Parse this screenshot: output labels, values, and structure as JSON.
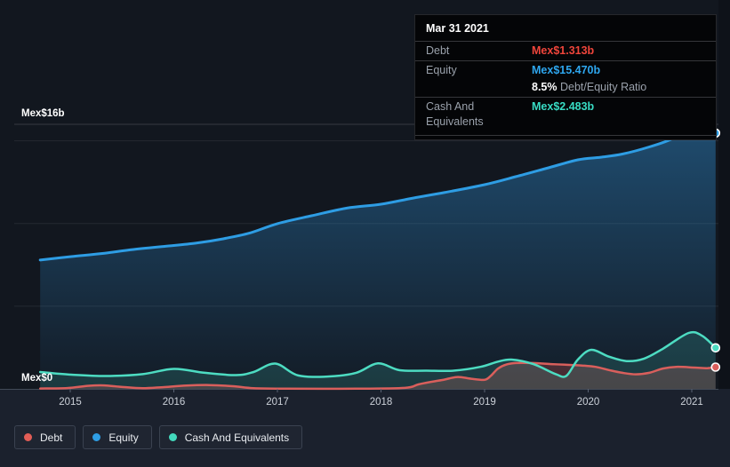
{
  "tooltip": {
    "date": "Mar 31 2021",
    "debt_label": "Debt",
    "debt_value": "Mex$1.313b",
    "debt_color": "#ef453b",
    "equity_label": "Equity",
    "equity_value": "Mex$15.470b",
    "equity_color": "#2ea6ee",
    "ratio_value": "8.5%",
    "ratio_label": "Debt/Equity Ratio",
    "cash_label": "Cash And Equivalents",
    "cash_value": "Mex$2.483b",
    "cash_color": "#38dcc4"
  },
  "legend": {
    "items": [
      {
        "label": "Debt",
        "color": "#e25d56"
      },
      {
        "label": "Equity",
        "color": "#2e9de4"
      },
      {
        "label": "Cash And Equivalents",
        "color": "#43d9bd"
      }
    ]
  },
  "chart_data": {
    "type": "area",
    "ylabel_top": "Mex$16b",
    "ylabel_bottom": "Mex$0",
    "ylim": [
      0,
      16
    ],
    "x_ticks": [
      "2015",
      "2016",
      "2017",
      "2018",
      "2019",
      "2020",
      "2021"
    ],
    "gridlines": [
      16,
      15,
      10,
      5
    ],
    "grid": true,
    "legend_position": "bottom-left",
    "x_unit": "year",
    "y_unit": "Mex$ billions",
    "series": [
      {
        "name": "Equity",
        "color": "#2e9de4",
        "area_gradient": true,
        "points": [
          [
            2014.71,
            7.79
          ],
          [
            2015.01,
            8.0
          ],
          [
            2015.31,
            8.19
          ],
          [
            2015.61,
            8.43
          ],
          [
            2015.91,
            8.62
          ],
          [
            2016.21,
            8.81
          ],
          [
            2016.47,
            9.07
          ],
          [
            2016.73,
            9.42
          ],
          [
            2017.0,
            9.99
          ],
          [
            2017.33,
            10.47
          ],
          [
            2017.67,
            10.93
          ],
          [
            2018.0,
            11.17
          ],
          [
            2018.31,
            11.54
          ],
          [
            2018.61,
            11.87
          ],
          [
            2019.0,
            12.35
          ],
          [
            2019.3,
            12.83
          ],
          [
            2019.6,
            13.34
          ],
          [
            2019.9,
            13.85
          ],
          [
            2020.12,
            14.01
          ],
          [
            2020.33,
            14.2
          ],
          [
            2020.59,
            14.63
          ],
          [
            2020.8,
            15.09
          ],
          [
            2020.97,
            15.7
          ],
          [
            2021.06,
            15.81
          ],
          [
            2021.14,
            15.68
          ],
          [
            2021.23,
            15.47
          ]
        ]
      },
      {
        "name": "Debt",
        "color": "#d95f5c",
        "area_fill": "rgba(214,85,80,0.27)",
        "points": [
          [
            2014.71,
            0.02
          ],
          [
            2014.97,
            0.05
          ],
          [
            2015.18,
            0.19
          ],
          [
            2015.33,
            0.21
          ],
          [
            2015.48,
            0.13
          ],
          [
            2015.7,
            0.04
          ],
          [
            2015.91,
            0.11
          ],
          [
            2016.12,
            0.2
          ],
          [
            2016.34,
            0.23
          ],
          [
            2016.57,
            0.16
          ],
          [
            2016.77,
            0.04
          ],
          [
            2017.07,
            0.01
          ],
          [
            2017.76,
            0.01
          ],
          [
            2018.23,
            0.06
          ],
          [
            2018.36,
            0.27
          ],
          [
            2018.49,
            0.43
          ],
          [
            2018.61,
            0.56
          ],
          [
            2018.74,
            0.72
          ],
          [
            2018.87,
            0.61
          ],
          [
            2019.0,
            0.55
          ],
          [
            2019.06,
            0.79
          ],
          [
            2019.13,
            1.23
          ],
          [
            2019.21,
            1.47
          ],
          [
            2019.3,
            1.56
          ],
          [
            2019.47,
            1.56
          ],
          [
            2019.64,
            1.5
          ],
          [
            2019.82,
            1.45
          ],
          [
            2019.94,
            1.41
          ],
          [
            2020.07,
            1.33
          ],
          [
            2020.2,
            1.14
          ],
          [
            2020.33,
            0.97
          ],
          [
            2020.46,
            0.88
          ],
          [
            2020.59,
            0.97
          ],
          [
            2020.72,
            1.23
          ],
          [
            2020.85,
            1.33
          ],
          [
            2021.02,
            1.29
          ],
          [
            2021.15,
            1.25
          ],
          [
            2021.23,
            1.313
          ]
        ]
      },
      {
        "name": "Cash And Equivalents",
        "color": "#4ddcc2",
        "area_fill": "rgba(77,220,196,0.16)",
        "points": [
          [
            2014.71,
            1.02
          ],
          [
            2015.01,
            0.86
          ],
          [
            2015.35,
            0.78
          ],
          [
            2015.7,
            0.89
          ],
          [
            2016.0,
            1.21
          ],
          [
            2016.3,
            0.97
          ],
          [
            2016.6,
            0.83
          ],
          [
            2016.77,
            1.02
          ],
          [
            2016.98,
            1.53
          ],
          [
            2017.2,
            0.81
          ],
          [
            2017.5,
            0.75
          ],
          [
            2017.76,
            0.97
          ],
          [
            2017.97,
            1.54
          ],
          [
            2018.18,
            1.13
          ],
          [
            2018.44,
            1.1
          ],
          [
            2018.7,
            1.1
          ],
          [
            2018.96,
            1.33
          ],
          [
            2019.13,
            1.65
          ],
          [
            2019.26,
            1.77
          ],
          [
            2019.47,
            1.5
          ],
          [
            2019.69,
            0.88
          ],
          [
            2019.79,
            0.79
          ],
          [
            2019.9,
            1.77
          ],
          [
            2020.03,
            2.36
          ],
          [
            2020.2,
            1.95
          ],
          [
            2020.37,
            1.68
          ],
          [
            2020.54,
            1.83
          ],
          [
            2020.72,
            2.42
          ],
          [
            2020.97,
            3.38
          ],
          [
            2021.1,
            3.21
          ],
          [
            2021.23,
            2.483
          ]
        ]
      }
    ]
  }
}
